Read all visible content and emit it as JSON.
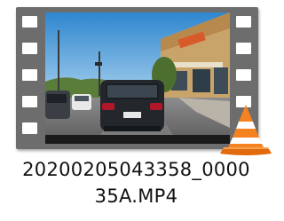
{
  "file": {
    "name_line1": "20200205043358_0000",
    "name_line2": "35A.MP4"
  },
  "thumbnail": {
    "description_icon": "video-thumbnail",
    "overlay_icon": "vlc-cone-icon"
  },
  "colors": {
    "film": "#6d6d6d",
    "sky": "#4aa0d8",
    "vlc_orange": "#f58220"
  }
}
